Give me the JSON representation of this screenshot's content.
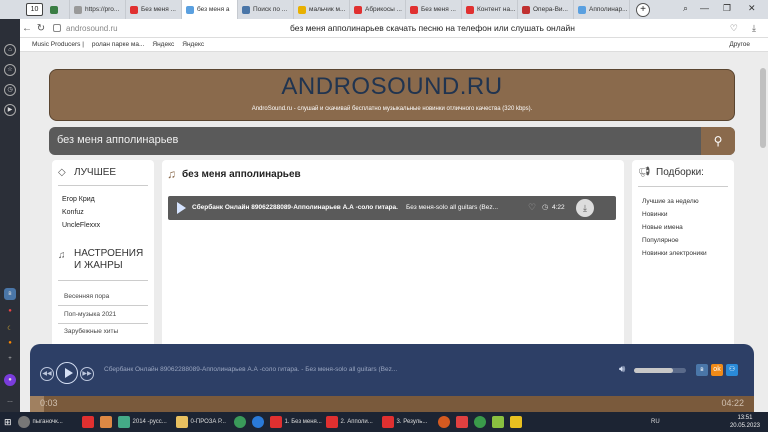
{
  "browser": {
    "tab_count": "10",
    "tabs": [
      {
        "label": "",
        "color": "#3a7d44"
      },
      {
        "label": "https://pro...",
        "color": "#999"
      },
      {
        "label": "Без меня ...",
        "color": "#e03030"
      },
      {
        "label": "без меня a",
        "color": "#5aa0e0"
      },
      {
        "label": "Поиск по ...",
        "color": "#4a76a8"
      },
      {
        "label": "мальчик м...",
        "color": "#e8b000"
      },
      {
        "label": "Абрикосы ...",
        "color": "#e03030"
      },
      {
        "label": "Без меня ...",
        "color": "#e03030"
      },
      {
        "label": "Контент на...",
        "color": "#e03030"
      },
      {
        "label": "Опера-Ви...",
        "color": "#c03030"
      },
      {
        "label": "Апполинар...",
        "color": "#5aa0e0"
      }
    ],
    "url": "androsound.ru",
    "page_title": "без меня апполинарьев скачать песню на телефон или слушать онлайн",
    "bookmarks": [
      "Music Producers |",
      "ролан парке ма...",
      "Яндекс",
      "Яндекс"
    ],
    "other_bookmarks": "Другое"
  },
  "site": {
    "logo": "ANDROSOUND.RU",
    "tagline": "AndroSound.ru - слушай и скачивай бесплатно музыкальные новинки отличного качества (320 kbps).",
    "search_value": "без меня апполинарьев"
  },
  "left": {
    "best_heading": "ЛУЧШЕЕ",
    "best_items": [
      "Егор Крид",
      "Konfuz",
      "UncleFlexxx"
    ],
    "moods_heading": "НАСТРОЕНИЯ И ЖАНРЫ",
    "mood_items": [
      "Весенняя пора",
      "Поп-музыка 2021",
      "Зарубежные хиты"
    ]
  },
  "center": {
    "title": "без меня апполинарьев",
    "track_artist": "Сбербанк Онлайн 89062288089-Апполинарьев А.А -соло гитара.",
    "track_name": "Без меня-solo all guitars (Bez...",
    "track_duration": "4:22"
  },
  "right": {
    "heading": "Подборки:",
    "items": [
      "Лучшие за неделю",
      "Новинки",
      "Новые имена",
      "Популярное",
      "Новинки электроники"
    ]
  },
  "player": {
    "info": "Сбербанк Онлайн 89062288089-Апполинарьев А.А -соло гитара. - Без меня-solo all guitars (Bez...",
    "current_time": "0:03",
    "total_time": "04:22",
    "volume": 0.75,
    "progress": 0.02
  },
  "taskbar": {
    "start": "пыганочк...",
    "items": [
      "2014 -русс...",
      "0-ПРОЗА Р...",
      "1. Без меня...",
      "2. Апполи...",
      "3. Резуль..."
    ],
    "lang": "RU",
    "time": "13:51",
    "date": "20.05.2023"
  },
  "colors": {
    "header": "#8a6a4c",
    "player": "#2d3f66",
    "logo": "#203450"
  }
}
